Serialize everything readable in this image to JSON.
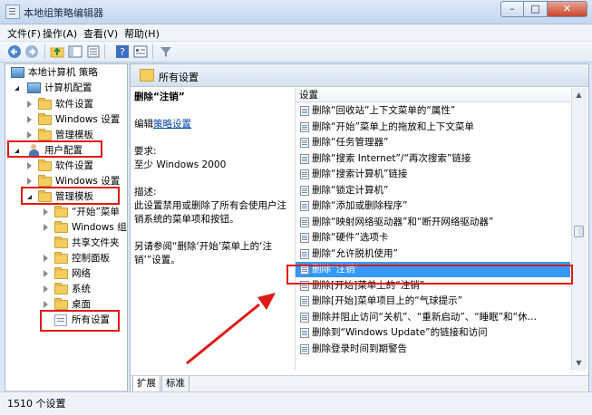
{
  "window": {
    "title": "本地组策略编辑器",
    "minimize_glyph": "–",
    "maximize_glyph": "□",
    "close_glyph": "✕"
  },
  "menu": [
    "文件(F)",
    "操作(A)",
    "查看(V)",
    "帮助(H)"
  ],
  "toolbar_icons": [
    "back-arrow-icon",
    "forward-arrow-icon",
    "up-folder-icon",
    "show-hide-tree-icon",
    "export-list-icon",
    "help-icon",
    "properties-icon",
    "filter-icon"
  ],
  "tree": {
    "root": "本地计算机 策略",
    "computer_config": "计算机配置",
    "computer_children": [
      "软件设置",
      "Windows 设置",
      "管理模板"
    ],
    "user_config": "用户配置",
    "user_children": [
      "软件设置",
      "Windows 设置",
      "管理模板"
    ],
    "admin_children": [
      "“开始”菜单",
      "Windows 组",
      "共享文件夹",
      "控制面板",
      "网络",
      "系统",
      "桌面"
    ],
    "all_settings": "所有设置"
  },
  "right_pane": {
    "header": "所有设置",
    "desc_title": "删除“注销”",
    "desc_edit_prefix": "编辑",
    "desc_edit_link": "策略设置",
    "desc_requirement_label": "要求:",
    "desc_requirement": "至少 Windows 2000",
    "desc_description_label": "描述:",
    "desc_description": "此设置禁用或删除了所有会使用户注销系统的菜单项和按钮。",
    "desc_see_also": "另请参阅“删除‘开始’菜单上的‘注销’”设置。",
    "list_header": "设置",
    "list": [
      "删除“回收站”上下文菜单的“属性”",
      "删除“开始”菜单上的拖放和上下文菜单",
      "删除“任务管理器”",
      "删除“搜索 Internet”/“再次搜索”链接",
      "删除“搜索计算机”链接",
      "删除“锁定计算机”",
      "删除“添加或删除程序”",
      "删除“映射网络驱动器”和“断开网络驱动器”",
      "删除“硬件”选项卡",
      "删除“允许脱机使用”",
      "删除“注销”",
      "删除[开始]菜单上的“注销”",
      "删除[开始]菜单项目上的“气球提示”",
      "删除并阻止访问“关机”、“重新启动”、“睡眠”和“休…",
      "删除到“Windows Update”的链接和访问",
      "删除登录时间到期警告"
    ],
    "selected_index": 10,
    "tabs": [
      "扩展",
      "标准"
    ]
  },
  "status": "1510 个设置",
  "highlight_color": "#e01818"
}
